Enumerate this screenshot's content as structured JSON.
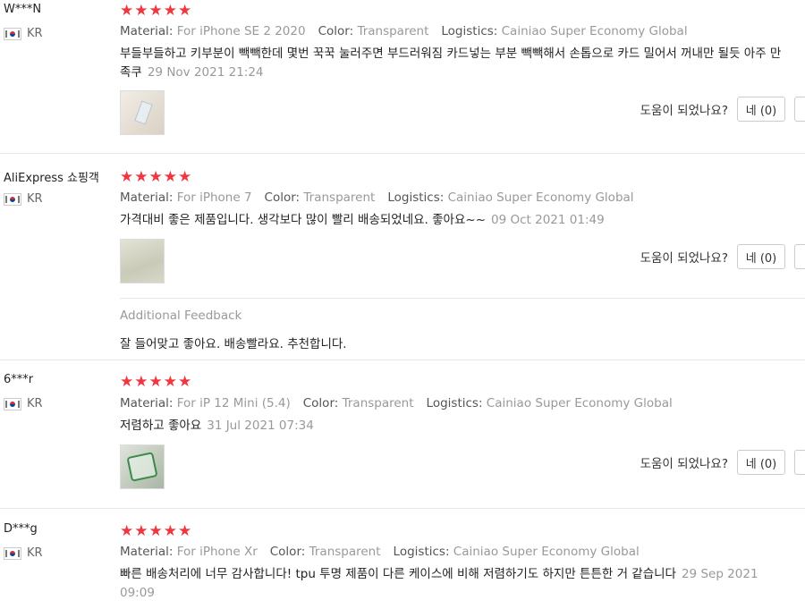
{
  "reviews": [
    {
      "user": "W***N",
      "country": "KR",
      "rating": "★★★★★",
      "material_label": "Material:",
      "material": "For iPhone SE 2 2020",
      "color_label": "Color:",
      "color": "Transparent",
      "logistics_label": "Logistics:",
      "logistics": "Cainiao Super Economy Global",
      "text": "부들부들하고 키부분이 빽빽한데 몇번 꾹꾹 눌러주면 부드러워짐 카드넣는 부분 빽빽해서 손톱으로 카드 밀어서 꺼내만 될듯 아주 만족쿠",
      "date": "29 Nov 2021 21:24",
      "helpful_q": "도움이 되었나요?",
      "yes_btn": "네 (0)"
    },
    {
      "user": "AliExpress 쇼핑객",
      "country": "KR",
      "rating": "★★★★★",
      "material_label": "Material:",
      "material": "For iPhone 7",
      "color_label": "Color:",
      "color": "Transparent",
      "logistics_label": "Logistics:",
      "logistics": "Cainiao Super Economy Global",
      "text": "가격대비 좋은 제품입니다. 생각보다 많이 빨리 배송되었네요. 좋아요~~",
      "date": "09 Oct 2021 01:49",
      "helpful_q": "도움이 되었나요?",
      "yes_btn": "네 (0)",
      "additional_title": "Additional Feedback",
      "additional_text": "잘 들어맞고 좋아요. 배송빨라요. 추천합니다."
    },
    {
      "user": "6***r",
      "country": "KR",
      "rating": "★★★★★",
      "material_label": "Material:",
      "material": "For iP 12 Mini (5.4)",
      "color_label": "Color:",
      "color": "Transparent",
      "logistics_label": "Logistics:",
      "logistics": "Cainiao Super Economy Global",
      "text": "저렴하고 좋아요",
      "date": "31 Jul 2021 07:34",
      "helpful_q": "도움이 되었나요?",
      "yes_btn": "네 (0)"
    },
    {
      "user": "D***g",
      "country": "KR",
      "rating": "★★★★★",
      "material_label": "Material:",
      "material": "For iPhone Xr",
      "color_label": "Color:",
      "color": "Transparent",
      "logistics_label": "Logistics:",
      "logistics": "Cainiao Super Economy Global",
      "text": "빠른 배송처리에 너무 감사합니다! tpu 투명 제품이 다른 케이스에 비해 저렴하기도 하지만 튼튼한 거 같습니다",
      "date": "29 Sep 2021 09:09"
    }
  ],
  "colors": {
    "star": "#f0373f",
    "muted": "#999999",
    "divider": "#e8e8e8"
  }
}
